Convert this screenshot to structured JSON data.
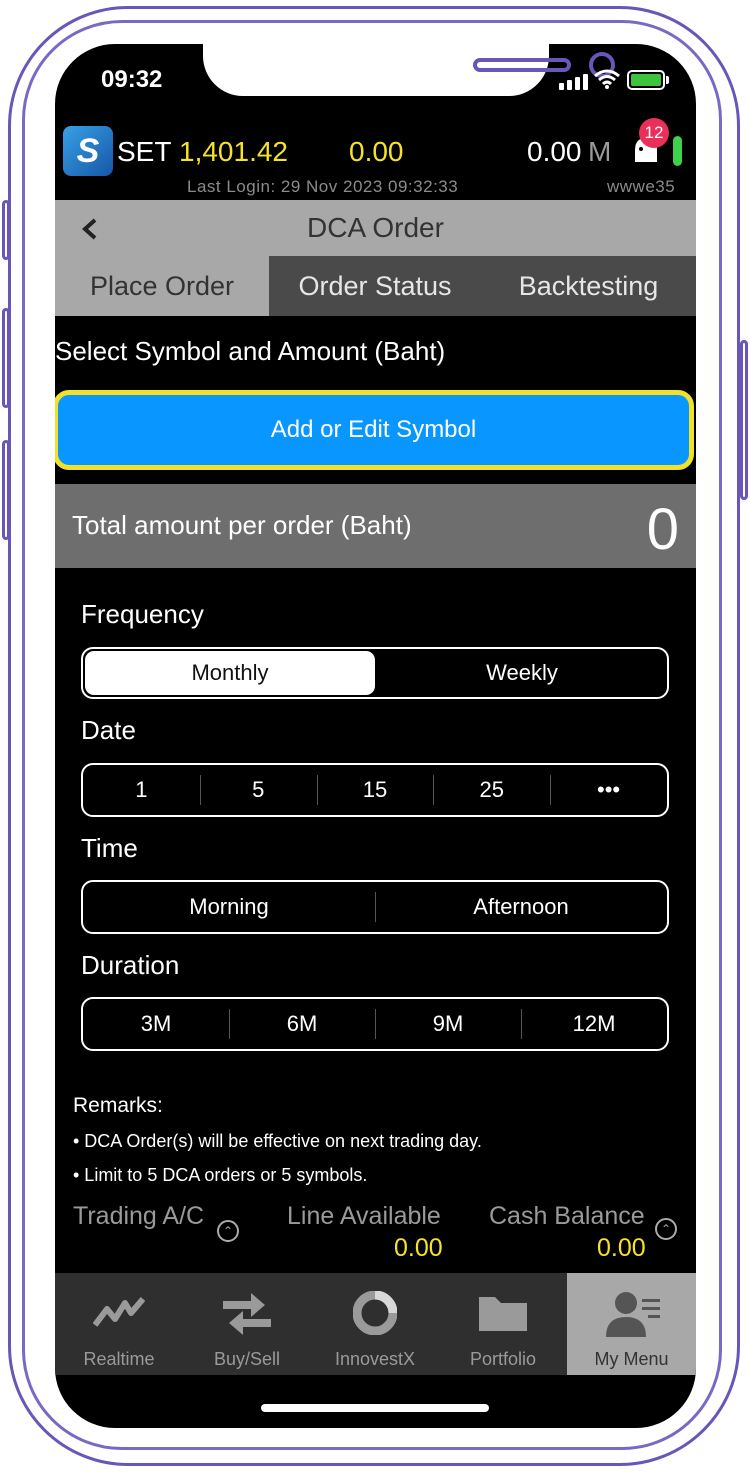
{
  "status_bar": {
    "time": "09:32"
  },
  "ticker": {
    "market": "SET",
    "index": "1,401.42",
    "change": "0.00",
    "volume": "0.00",
    "volume_unit": "M",
    "notification_count": "12",
    "last_login": "Last Login: 29 Nov 2023 09:32:33",
    "user_id": "wwwe35"
  },
  "header": {
    "title": "DCA Order"
  },
  "tabs": [
    {
      "label": "Place Order",
      "active": true
    },
    {
      "label": "Order Status",
      "active": false
    },
    {
      "label": "Backtesting",
      "active": false
    }
  ],
  "form": {
    "section_label": "Select Symbol and Amount (Baht)",
    "add_button": "Add or Edit Symbol",
    "total_label": "Total amount per order (Baht)",
    "total_value": "0",
    "frequency": {
      "label": "Frequency",
      "options": [
        "Monthly",
        "Weekly"
      ],
      "selected": "Monthly"
    },
    "date": {
      "label": "Date",
      "options": [
        "1",
        "5",
        "15",
        "25",
        "•••"
      ]
    },
    "time": {
      "label": "Time",
      "options": [
        "Morning",
        "Afternoon"
      ]
    },
    "duration": {
      "label": "Duration",
      "options": [
        "3M",
        "6M",
        "9M",
        "12M"
      ]
    }
  },
  "remarks": {
    "title": "Remarks:",
    "items": [
      "• DCA Order(s) will be effective on next trading day.",
      "• Limit to 5 DCA orders or 5 symbols."
    ]
  },
  "account": {
    "trading_label": "Trading A/C",
    "line_label": "Line Available",
    "line_value": "0.00",
    "cash_label": "Cash Balance",
    "cash_value": "0.00"
  },
  "nav": [
    {
      "label": "Realtime",
      "icon": "line-chart-icon",
      "active": false
    },
    {
      "label": "Buy/Sell",
      "icon": "exchange-arrows-icon",
      "active": false
    },
    {
      "label": "InnovestX",
      "icon": "innovestx-icon",
      "active": false
    },
    {
      "label": "Portfolio",
      "icon": "folder-icon",
      "active": false
    },
    {
      "label": "My Menu",
      "icon": "user-menu-icon",
      "active": true
    }
  ],
  "colors": {
    "accent_blue": "#0a96ff",
    "highlight_yellow": "#f5e22a",
    "badge_pink": "#e8305a"
  }
}
